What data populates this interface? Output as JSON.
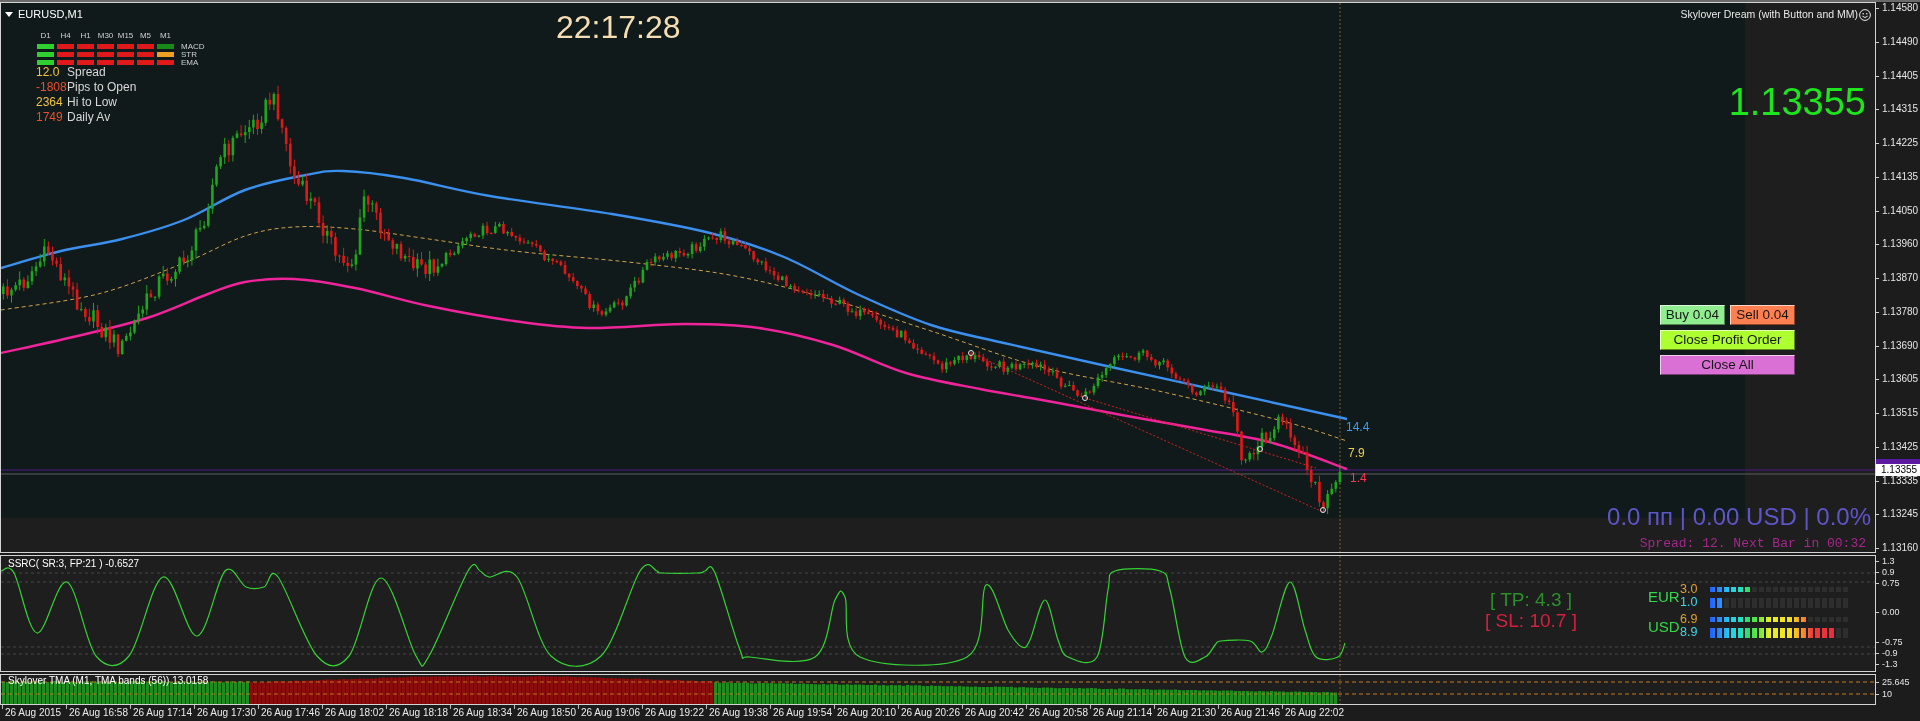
{
  "chart": {
    "symbol": "EURUSD,M1",
    "clock": "22:17:28",
    "indicator_title": "Skylover Dream (with Button and MM)",
    "current_price": "1.13355",
    "profit_summary": "0.0 пп | 0.00 USD | 0.0%",
    "bar_info": "Spread: 12. Next Bar in 00:32"
  },
  "trend_matrix": {
    "timeframes": [
      "D1",
      "H4",
      "H1",
      "M30",
      "M15",
      "M5",
      "M1"
    ],
    "rows": [
      {
        "label": "MACD",
        "cells": [
          {
            "color": "#2fd12f"
          },
          {
            "color": "#e01a1a"
          },
          {
            "color": "#e01a1a"
          },
          {
            "color": "#e01a1a"
          },
          {
            "color": "#e01a1a"
          },
          {
            "color": "#e01a1a"
          },
          {
            "color": "#168c16"
          }
        ]
      },
      {
        "label": "STR",
        "cells": [
          {
            "color": "#2fd12f"
          },
          {
            "color": "#e01a1a"
          },
          {
            "color": "#e01a1a"
          },
          {
            "color": "#e01a1a"
          },
          {
            "color": "#e01a1a"
          },
          {
            "color": "#e01a1a"
          },
          {
            "color": "#f0a020"
          }
        ]
      },
      {
        "label": "EMA",
        "cells": [
          {
            "color": "#2fd12f"
          },
          {
            "color": "#e01a1a"
          },
          {
            "color": "#e01a1a"
          },
          {
            "color": "#e01a1a"
          },
          {
            "color": "#e01a1a"
          },
          {
            "color": "#e01a1a"
          },
          {
            "color": "#e01a1a"
          }
        ]
      }
    ]
  },
  "stats": [
    {
      "number": "12.0",
      "caption": "Spread",
      "color": "#f2c440"
    },
    {
      "number": "-1808",
      "caption": "Pips to Open",
      "color": "#e8502a"
    },
    {
      "number": "2364",
      "caption": "Hi to Low",
      "color": "#f2c440"
    },
    {
      "number": "1749",
      "caption": "Daily Av",
      "color": "#e8502a"
    }
  ],
  "buttons": [
    {
      "label": "Buy 0.04",
      "kind": "half",
      "color": "#90ee90"
    },
    {
      "label": "Sell 0.04",
      "kind": "half",
      "color": "#ff7f50"
    },
    {
      "label": "Close Profit Order",
      "kind": "wide",
      "color": "#adff2f"
    },
    {
      "label": "Close All",
      "kind": "wide",
      "color": "#da70d6"
    }
  ],
  "ma_labels": [
    {
      "text": "14.4",
      "color": "#3c9cf2"
    },
    {
      "text": "7.9",
      "color": "#eed34a"
    },
    {
      "text": "1.4",
      "color": "#ff3552"
    }
  ],
  "price_scale": {
    "labels": [
      "1.14580",
      "1.14490",
      "1.14405",
      "1.14315",
      "1.14225",
      "1.14135",
      "1.14050",
      "1.13960",
      "1.13870",
      "1.13780",
      "1.13690",
      "1.13605",
      "1.13515",
      "1.13425",
      "1.13335",
      "1.13245",
      "1.13160"
    ],
    "current": "1.13355"
  },
  "oscillator": {
    "title": "SSRC( SR:3, FP:21 ) -0.6527",
    "scale": [
      "1.3",
      "0.9",
      "0.75",
      "0.00",
      "-0.75",
      "-0.9",
      "-1.3"
    ],
    "take_profit": "[ TP: 4.3 ]",
    "stop_loss": "[ SL: 10.7 ]",
    "currency_strength": [
      {
        "currency": "EUR",
        "rows": [
          {
            "value": "3.0",
            "level": 0.3,
            "kind": "thin"
          },
          {
            "value": "1.0",
            "level": 0.1,
            "kind": "thick"
          }
        ]
      },
      {
        "currency": "USD",
        "rows": [
          {
            "value": "6.9",
            "level": 0.69,
            "kind": "thin"
          },
          {
            "value": "8.9",
            "level": 0.89,
            "kind": "thick"
          }
        ]
      }
    ]
  },
  "tma": {
    "title": "Skylover TMA (M1, TMA bands (56)) 13.0158",
    "scale": [
      "25.645",
      "10"
    ]
  },
  "time_axis": [
    "26 Aug 2015",
    "26 Aug 16:58",
    "26 Aug 17:14",
    "26 Aug 17:30",
    "26 Aug 17:46",
    "26 Aug 18:02",
    "26 Aug 18:18",
    "26 Aug 18:34",
    "26 Aug 18:50",
    "26 Aug 19:06",
    "26 Aug 19:22",
    "26 Aug 19:38",
    "26 Aug 19:54",
    "26 Aug 20:10",
    "26 Aug 20:26",
    "26 Aug 20:42",
    "26 Aug 20:58",
    "26 Aug 21:14",
    "26 Aug 21:30",
    "26 Aug 21:46",
    "26 Aug 22:02"
  ]
}
